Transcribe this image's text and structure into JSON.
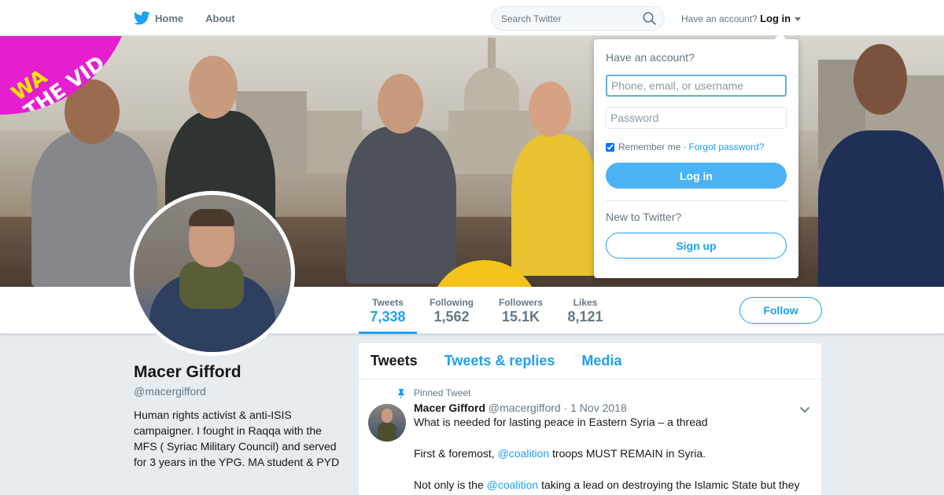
{
  "nav": {
    "home_label": "Home",
    "about_label": "About",
    "search_placeholder": "Search Twitter",
    "have_account": "Have an account?",
    "login_label": "Log in"
  },
  "banner": {
    "overlay_line1": "WA",
    "overlay_line2": "THE VID"
  },
  "stats": [
    {
      "label": "Tweets",
      "value": "7,338"
    },
    {
      "label": "Following",
      "value": "1,562"
    },
    {
      "label": "Followers",
      "value": "15.1K"
    },
    {
      "label": "Likes",
      "value": "8,121"
    }
  ],
  "follow_label": "Follow",
  "profile": {
    "name": "Macer Gifford",
    "handle": "@macergifford",
    "bio": "Human rights activist & anti-ISIS campaigner. I fought in Raqqa with the MFS ( Syriac Military Council) and served for 3 years in the YPG. MA student & PYD"
  },
  "timeline": {
    "tabs": [
      "Tweets",
      "Tweets & replies",
      "Media"
    ],
    "tweet": {
      "pinned_label": "Pinned Tweet",
      "author": "Macer Gifford",
      "handle": "@macergifford",
      "dot": "·",
      "date": "1 Nov 2018",
      "line1": "What is needed for lasting peace in Eastern Syria – a thread",
      "line2_pre": "First & foremost, ",
      "line2_link": "@coalition",
      "line2_post": " troops MUST REMAIN in Syria.",
      "line3_pre": "Not only is the ",
      "line3_link": "@coalition",
      "line3_post": " taking a lead on destroying the Islamic State but they"
    }
  },
  "login_dropdown": {
    "heading": "Have an account?",
    "username_placeholder": "Phone, email, or username",
    "password_placeholder": "Password",
    "remember_me": "Remember me",
    "separator": "·",
    "forgot_password": "Forgot password?",
    "login_button": "Log in",
    "new_to_twitter": "New to Twitter?",
    "signup_button": "Sign up"
  },
  "colors": {
    "accent": "#1da1f2",
    "login_button_bg": "#4ab3f4",
    "badge_magenta": "#e51fcf"
  }
}
